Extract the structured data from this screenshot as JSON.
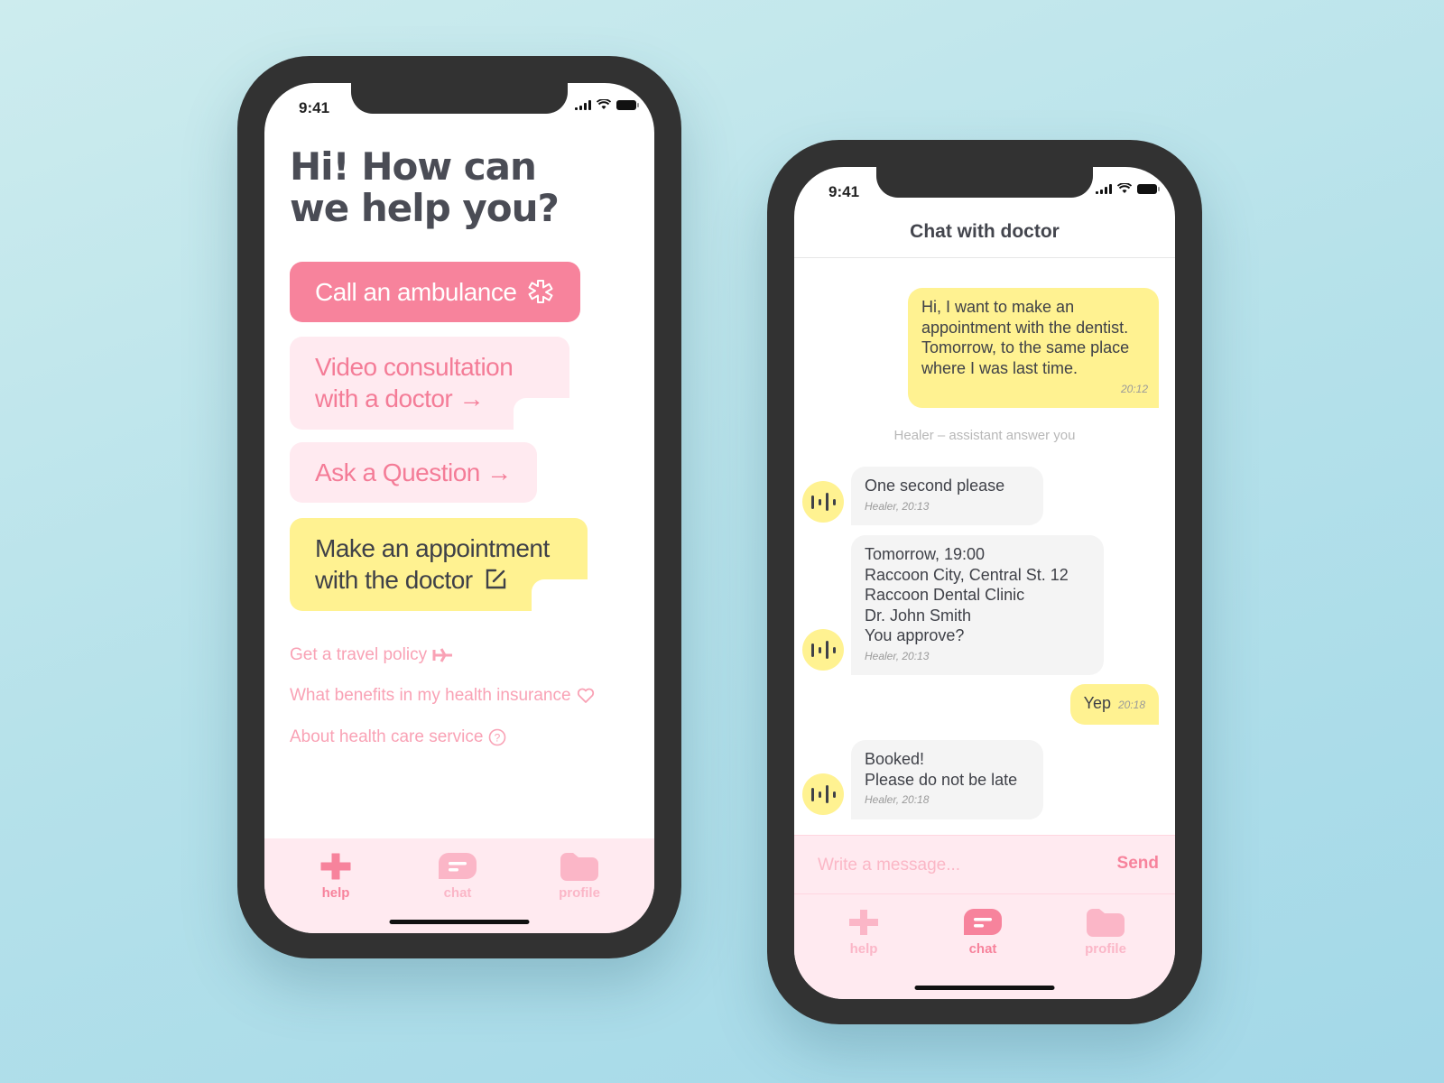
{
  "colors": {
    "accent_pink": "#f7839c",
    "light_pink": "#ffeaf0",
    "yellow": "#fff291",
    "dark_text": "#43454d"
  },
  "left_phone": {
    "status": {
      "time": "9:41"
    },
    "heading_line1": "Hi! How can",
    "heading_line2": "we help you?",
    "actions": [
      {
        "label": "Call an ambulance",
        "icon": "asterisk-medical-icon"
      },
      {
        "label_line1": "Video consultation",
        "label_line2": "with a doctor",
        "icon": "arrow-right-icon"
      },
      {
        "label": "Ask a Question",
        "icon": "arrow-right-icon"
      },
      {
        "label_line1": "Make an appointment",
        "label_line2": "with the doctor",
        "icon": "edit-icon"
      }
    ],
    "links": [
      {
        "label": "Get a travel policy",
        "icon": "airplane-icon"
      },
      {
        "label": "What benefits in my health insurance",
        "icon": "heart-icon"
      },
      {
        "label": "About health care service",
        "icon": "question-circle-icon"
      }
    ],
    "tabs": [
      {
        "label": "help",
        "active": true
      },
      {
        "label": "chat",
        "active": false
      },
      {
        "label": "profile",
        "active": false
      }
    ]
  },
  "right_phone": {
    "status": {
      "time": "9:41"
    },
    "title": "Chat  with doctor",
    "messages": [
      {
        "from": "user",
        "text": "Hi, I want to make an appointment with the dentist. Tomorrow, to the same place where I was last time.",
        "time": "20:12"
      },
      {
        "from": "system",
        "text": "Healer – assistant answer you"
      },
      {
        "from": "bot",
        "text": "One second please",
        "meta": "Healer, 20:13"
      },
      {
        "from": "bot",
        "lines": [
          "Tomorrow, 19:00",
          "Raccoon City, Central St. 12",
          "Raccoon Dental Clinic",
          "Dr. John Smith",
          "You approve?"
        ],
        "meta": "Healer, 20:13"
      },
      {
        "from": "user",
        "text": "Yep",
        "time": "20:18"
      },
      {
        "from": "bot",
        "lines": [
          "Booked!",
          "Please do not be late"
        ],
        "meta": "Healer, 20:18"
      }
    ],
    "composer": {
      "placeholder": "Write a message...",
      "value": "",
      "send_label": "Send"
    },
    "tabs": [
      {
        "label": "help",
        "active": false
      },
      {
        "label": "chat",
        "active": true
      },
      {
        "label": "profile",
        "active": false
      }
    ]
  }
}
